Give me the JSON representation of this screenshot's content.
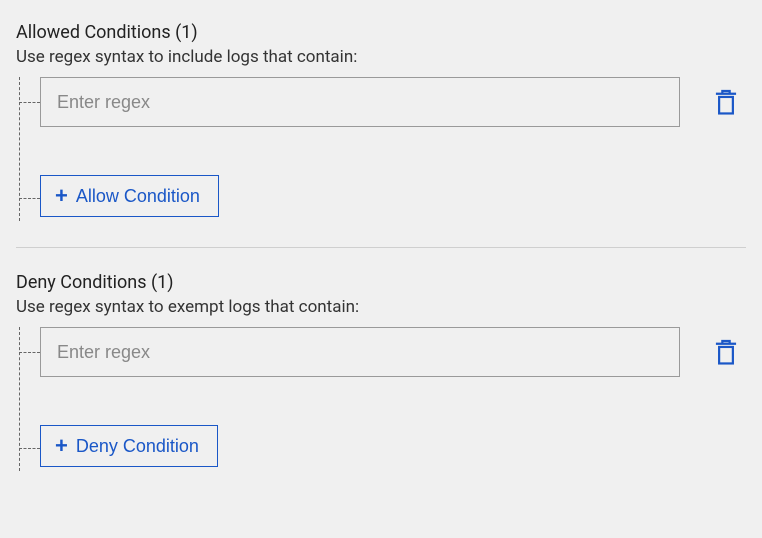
{
  "allowed": {
    "title": "Allowed Conditions (1)",
    "subtitle": "Use regex syntax to include logs that contain:",
    "inputs": [
      {
        "placeholder": "Enter regex",
        "value": ""
      }
    ],
    "add_label": "Allow Condition"
  },
  "deny": {
    "title": "Deny Conditions (1)",
    "subtitle": "Use regex syntax to exempt logs that contain:",
    "inputs": [
      {
        "placeholder": "Enter regex",
        "value": ""
      }
    ],
    "add_label": "Deny Condition"
  }
}
